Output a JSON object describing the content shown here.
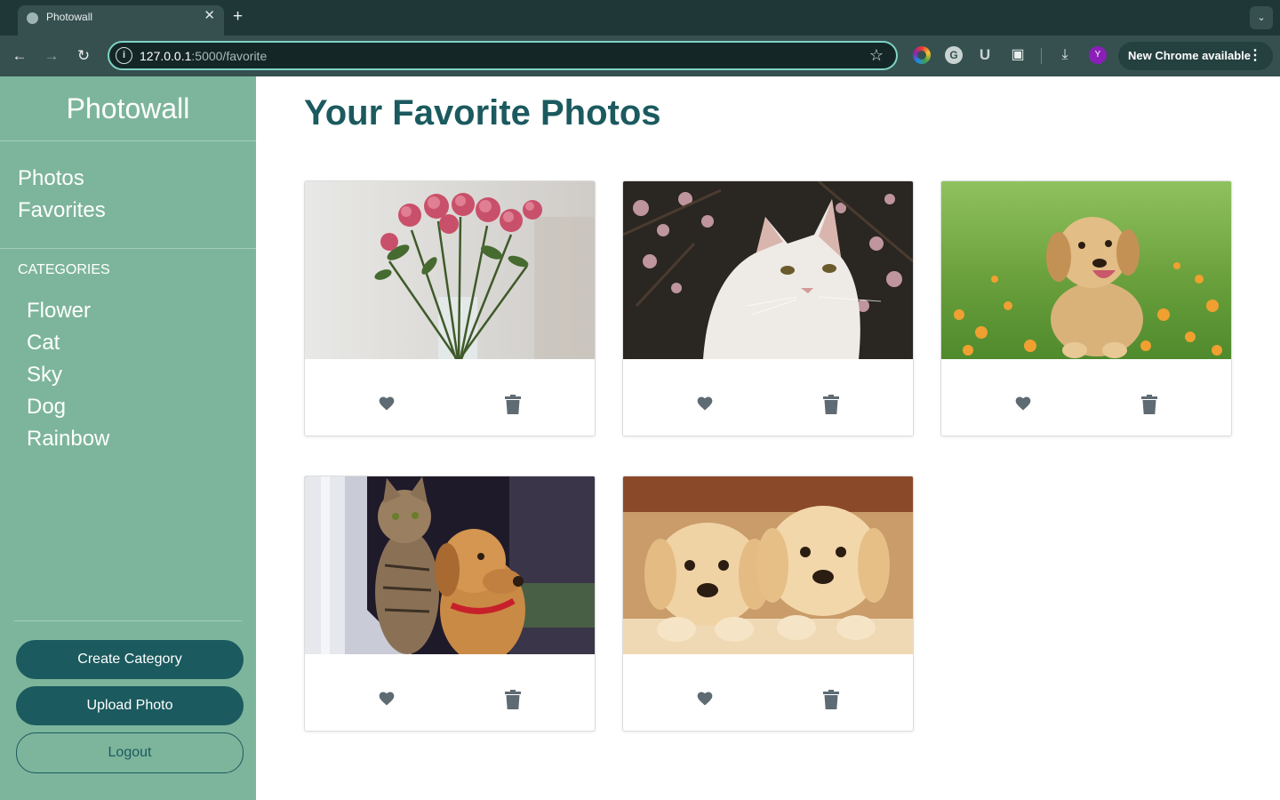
{
  "browser": {
    "tab_title": "Photowall",
    "tab_close": "✕",
    "new_tab": "+",
    "url_host": "127.0.0.1",
    "url_rest": ":5000/favorite",
    "profile_initial": "Y",
    "update_label": "New Chrome available",
    "extensions": [
      "color-picker-icon",
      "grammarly-icon",
      "u-extension-icon",
      "puzzle-icon"
    ],
    "accent_color": "#7fd4c6"
  },
  "sidebar": {
    "brand": "Photowall",
    "nav": [
      "Photos",
      "Favorites"
    ],
    "categories_heading": "CATEGORIES",
    "categories": [
      "Flower",
      "Cat",
      "Sky",
      "Dog",
      "Rainbow"
    ],
    "buttons": {
      "create_category": "Create Category",
      "upload_photo": "Upload Photo",
      "logout": "Logout"
    },
    "background_color": "#7db59c",
    "button_color": "#1b5a5e"
  },
  "main": {
    "title": "Your Favorite Photos",
    "photos": [
      {
        "subject": "pink roses in a vase",
        "favorited": true
      },
      {
        "subject": "white cat with cherry blossoms",
        "favorited": true
      },
      {
        "subject": "golden retriever puppy in flowers",
        "favorited": true
      },
      {
        "subject": "tabby cat and dog at window",
        "favorited": true
      },
      {
        "subject": "two golden retriever puppies",
        "favorited": true
      }
    ],
    "action_icons": [
      "heart-icon",
      "trash-icon"
    ],
    "icon_color": "#5f6b73"
  }
}
